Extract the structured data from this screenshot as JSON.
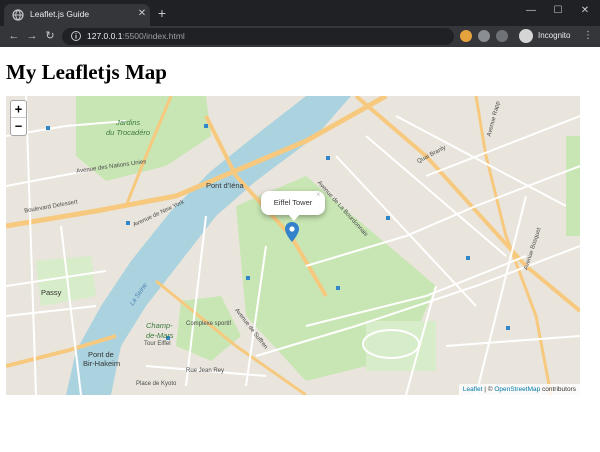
{
  "browser": {
    "tab_title": "Leaflet.js Guide",
    "url_host": "127.0.0.1",
    "url_rest": ":5500/index.html",
    "profile_label": "Incognito"
  },
  "icons": {
    "back": "arrow-left-icon",
    "forward": "arrow-right-icon",
    "reload": "reload-icon",
    "bookmark": "star-icon",
    "new_tab": "plus-icon",
    "close_tab": "close-icon",
    "menu": "kebab-menu-icon",
    "marker": "map-pin-icon"
  },
  "colors": {
    "chrome_dark": "#202124",
    "chrome_tab": "#35363a",
    "water": "#aad3df",
    "park": "#c8e6b3",
    "land": "#e9e5dc",
    "road_major": "#f7c97f",
    "marker": "#3383cc"
  },
  "page": {
    "title": "My Leafletjs Map"
  },
  "map": {
    "zoom_in": "+",
    "zoom_out": "−",
    "popup_text": "Eiffel Tower",
    "popup_close": "×",
    "attribution_leaflet": "Leaflet",
    "attribution_sep": " | © ",
    "attribution_osm": "OpenStreetMap",
    "attribution_suffix": " contributors",
    "labels": {
      "jardins1": "Jardins",
      "jardins2": "du Trocadéro",
      "pont_iena": "Pont d'Iéna",
      "passy": "Passy",
      "pont_bir1": "Pont de",
      "pont_bir2": "Bir-Hakeim",
      "champ1": "Champ-",
      "champ2": "de-Mars",
      "champ3": "Tour Eiffel",
      "quai_branly": "Quai Branly",
      "av_new_york": "Avenue de New York",
      "av_nations_unies": "Avenue des Nations Unies",
      "bd_delessert": "Boulevard Delessert",
      "av_suffren": "Avenue de Suffren",
      "av_bourdonnais": "Avenue de La Bourdonnais",
      "av_rapp": "Avenue Rapp",
      "av_bosquet": "Avenue Bosquet",
      "place_kyoto": "Place de Kyoto",
      "rue_jean_rey": "Rue Jean Rey",
      "seine": "La Seine",
      "complexe": "Complexe sportif"
    }
  }
}
